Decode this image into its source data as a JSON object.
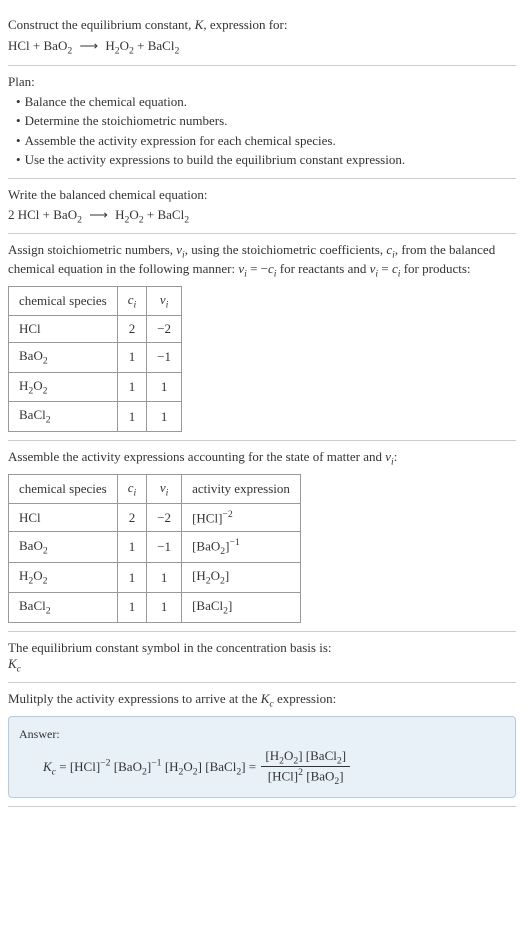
{
  "prompt": {
    "intro": "Construct the equilibrium constant, ",
    "k": "K",
    "intro2": ", expression for:",
    "equation_html": "HCl + BaO<span class='sub'>2</span> <span class='arrow'>⟶</span> H<span class='sub'>2</span>O<span class='sub'>2</span> + BaCl<span class='sub'>2</span>"
  },
  "plan": {
    "label": "Plan:",
    "items": [
      "Balance the chemical equation.",
      "Determine the stoichiometric numbers.",
      "Assemble the activity expression for each chemical species.",
      "Use the activity expressions to build the equilibrium constant expression."
    ]
  },
  "balanced": {
    "label": "Write the balanced chemical equation:",
    "equation_html": "2 HCl + BaO<span class='sub'>2</span> <span class='arrow'>⟶</span> H<span class='sub'>2</span>O<span class='sub'>2</span> + BaCl<span class='sub'>2</span>"
  },
  "stoich": {
    "intro_html": "Assign stoichiometric numbers, <span class='ital'>ν<span class='sub'>i</span></span>, using the stoichiometric coefficients, <span class='ital'>c<span class='sub'>i</span></span>, from the balanced chemical equation in the following manner: <span class='ital'>ν<span class='sub'>i</span></span> = −<span class='ital'>c<span class='sub'>i</span></span> for reactants and <span class='ital'>ν<span class='sub'>i</span></span> = <span class='ital'>c<span class='sub'>i</span></span> for products:",
    "headers": [
      "chemical species",
      "c<span class='sub'>i</span>",
      "ν<span class='sub'>i</span>"
    ],
    "rows": [
      {
        "species_html": "HCl",
        "c": "2",
        "v": "−2"
      },
      {
        "species_html": "BaO<span class='sub'>2</span>",
        "c": "1",
        "v": "−1"
      },
      {
        "species_html": "H<span class='sub'>2</span>O<span class='sub'>2</span>",
        "c": "1",
        "v": "1"
      },
      {
        "species_html": "BaCl<span class='sub'>2</span>",
        "c": "1",
        "v": "1"
      }
    ]
  },
  "activity": {
    "intro_html": "Assemble the activity expressions accounting for the state of matter and <span class='ital'>ν<span class='sub'>i</span></span>:",
    "headers": [
      "chemical species",
      "c<span class='sub'>i</span>",
      "ν<span class='sub'>i</span>",
      "activity expression"
    ],
    "rows": [
      {
        "species_html": "HCl",
        "c": "2",
        "v": "−2",
        "expr_html": "[HCl]<span class='sup'>−2</span>"
      },
      {
        "species_html": "BaO<span class='sub'>2</span>",
        "c": "1",
        "v": "−1",
        "expr_html": "[BaO<span class='sub'>2</span>]<span class='sup'>−1</span>"
      },
      {
        "species_html": "H<span class='sub'>2</span>O<span class='sub'>2</span>",
        "c": "1",
        "v": "1",
        "expr_html": "[H<span class='sub'>2</span>O<span class='sub'>2</span>]"
      },
      {
        "species_html": "BaCl<span class='sub'>2</span>",
        "c": "1",
        "v": "1",
        "expr_html": "[BaCl<span class='sub'>2</span>]"
      }
    ]
  },
  "symbol": {
    "label": "The equilibrium constant symbol in the concentration basis is:",
    "value_html": "<span class='ital'>K<span class='sub'>c</span></span>"
  },
  "multiply": {
    "label_html": "Mulitply the activity expressions to arrive at the <span class='ital'>K<span class='sub'>c</span></span> expression:"
  },
  "answer": {
    "label": "Answer:",
    "line_html": "<span class='ital'>K<span class='sub'>c</span></span> = [HCl]<span class='sup'>−2</span> [BaO<span class='sub'>2</span>]<span class='sup'>−1</span> [H<span class='sub'>2</span>O<span class='sub'>2</span>] [BaCl<span class='sub'>2</span>] = <span class='frac'><span class='num'>[H<span class='sub'>2</span>O<span class='sub'>2</span>] [BaCl<span class='sub'>2</span>]</span><span class='den'>[HCl]<span class='sup'>2</span> [BaO<span class='sub'>2</span>]</span></span>"
  }
}
